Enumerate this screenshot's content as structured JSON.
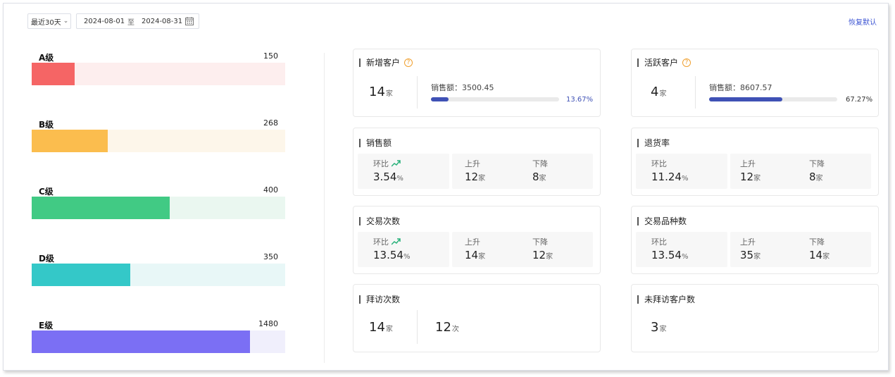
{
  "toolbar": {
    "period": "最近30天",
    "start_date": "2024-08-01",
    "range_sep": "至",
    "end_date": "2024-08-31",
    "reset": "恢复默认"
  },
  "levels": [
    {
      "name": "A级",
      "count": "150",
      "fill_ratio": 0.17,
      "color": "#f56565",
      "bg": "#fdeeee"
    },
    {
      "name": "B级",
      "count": "268",
      "fill_ratio": 0.3,
      "color": "#fbbd4e",
      "bg": "#fdf6ea"
    },
    {
      "name": "C级",
      "count": "400",
      "fill_ratio": 0.545,
      "color": "#41ca84",
      "bg": "#eaf7f0"
    },
    {
      "name": "D级",
      "count": "350",
      "fill_ratio": 0.39,
      "color": "#34c8c8",
      "bg": "#e8f7f7"
    },
    {
      "name": "E级",
      "count": "1480",
      "fill_ratio": 0.86,
      "color": "#7b6ff4",
      "bg": "#f0effc"
    }
  ],
  "cards": {
    "new_customers": {
      "title": "新增客户",
      "value": "14",
      "unit": "家",
      "sales_label": "销售额：3500.45",
      "pct": "13.67%",
      "ratio": 0.1367
    },
    "active_customers": {
      "title": "活跃客户",
      "value": "4",
      "unit": "家",
      "sales_label": "销售额：8607.57",
      "pct": "67.27%",
      "ratio": 0.5727
    },
    "sales": {
      "title": "销售额",
      "ratio_label": "环比",
      "ratio_value": "3.54",
      "ratio_unit": "%",
      "up_label": "上升",
      "up_value": "12",
      "up_unit": "家",
      "down_label": "下降",
      "down_value": "8",
      "down_unit": "家"
    },
    "return_rate": {
      "title": "退货率",
      "ratio_label": "环比",
      "ratio_value": "11.24",
      "ratio_unit": "%",
      "up_label": "上升",
      "up_value": "12",
      "up_unit": "家",
      "down_label": "下降",
      "down_value": "8",
      "down_unit": "家"
    },
    "transactions": {
      "title": "交易次数",
      "ratio_label": "环比",
      "ratio_value": "13.54",
      "ratio_unit": "%",
      "up_label": "上升",
      "up_value": "14",
      "up_unit": "家",
      "down_label": "下降",
      "down_value": "12",
      "down_unit": "家"
    },
    "product_types": {
      "title": "交易品种数",
      "ratio_label": "环比",
      "ratio_value": "13.54",
      "ratio_unit": "%",
      "up_label": "上升",
      "up_value": "35",
      "up_unit": "家",
      "down_label": "下降",
      "down_value": "14",
      "down_unit": "家"
    },
    "visits": {
      "title": "拜访次数",
      "value1": "14",
      "unit1": "家",
      "value2": "12",
      "unit2": "次"
    },
    "unvisited": {
      "title": "未拜访客户数",
      "value": "3",
      "unit": "家"
    }
  },
  "colors": {
    "accent": "#3f51b5",
    "link": "#3d55d3",
    "trend_up": "#2ab27b",
    "help": "#f0a030"
  },
  "icons": {
    "calendar": "calendar-icon",
    "help": "help-icon",
    "trend": "trend-up-icon",
    "dropdown": "chevron-down-icon"
  }
}
